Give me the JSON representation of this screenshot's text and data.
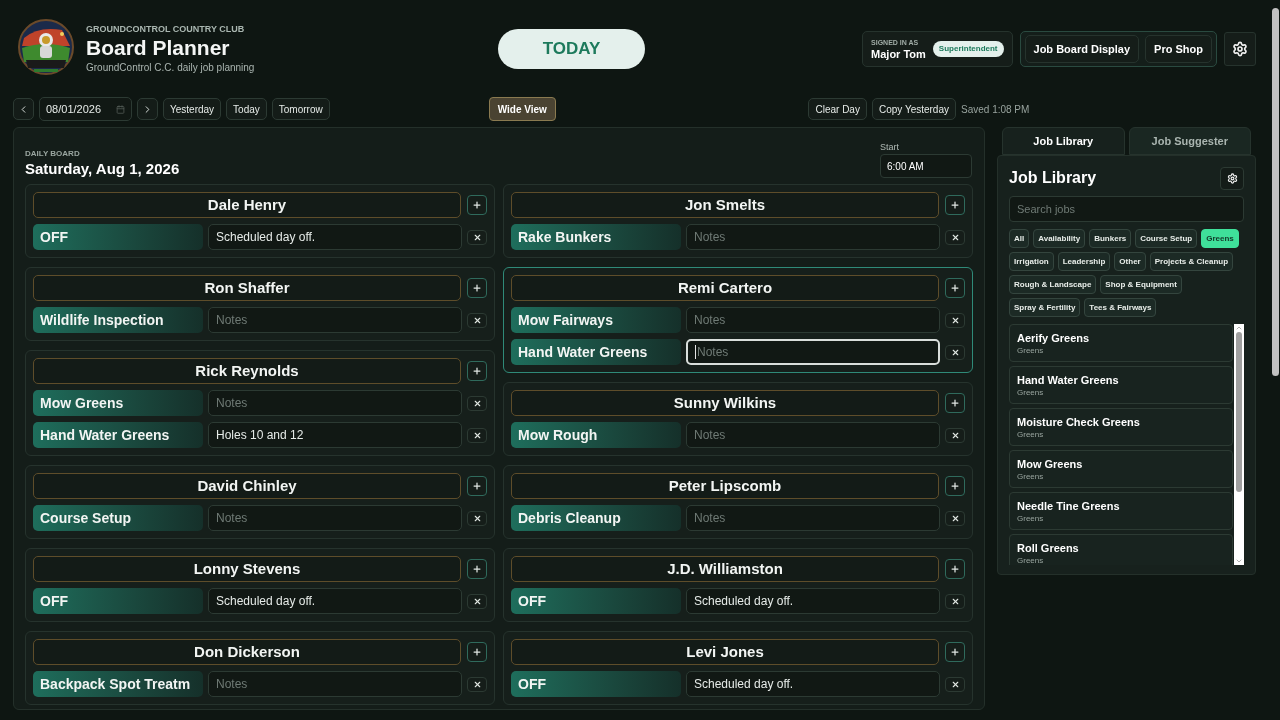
{
  "header": {
    "club": "GROUNDCONTROL COUNTRY CLUB",
    "title": "Board Planner",
    "subtitle": "GroundControl C.C. daily job planning"
  },
  "today_button": "TODAY",
  "user": {
    "caption": "SIGNED IN AS",
    "name": "Major Tom",
    "role": "Superintendent"
  },
  "nav": [
    "Job Board Display",
    "Pro Shop"
  ],
  "toolbar": {
    "date": "08/01/2026",
    "quick": [
      "Yesterday",
      "Today",
      "Tomorrow"
    ],
    "wide_view": "Wide View",
    "clear_day": "Clear Day",
    "copy_yesterday": "Copy Yesterday",
    "saved": "Saved 1:08 PM"
  },
  "board": {
    "caption": "DAILY BOARD",
    "date": "Saturday, Aug 1, 2026",
    "start_label": "Start",
    "start_value": "6:00 AM",
    "columns": [
      [
        {
          "name": "Dale Henry",
          "selected": false,
          "jobs": [
            {
              "job": "OFF",
              "notes": "Scheduled day off.",
              "focused": false
            }
          ]
        },
        {
          "name": "Ron Shaffer",
          "selected": false,
          "jobs": [
            {
              "job": "Wildlife Inspection",
              "placeholder": "Notes",
              "focused": false
            }
          ]
        },
        {
          "name": "Rick Reynolds",
          "selected": false,
          "jobs": [
            {
              "job": "Mow Greens",
              "placeholder": "Notes",
              "focused": false
            },
            {
              "job": "Hand Water Greens",
              "notes": "Holes 10 and 12",
              "focused": false
            }
          ]
        },
        {
          "name": "David Chinley",
          "selected": false,
          "jobs": [
            {
              "job": "Course Setup",
              "placeholder": "Notes",
              "focused": false
            }
          ]
        },
        {
          "name": "Lonny Stevens",
          "selected": false,
          "jobs": [
            {
              "job": "OFF",
              "notes": "Scheduled day off.",
              "focused": false
            }
          ]
        },
        {
          "name": "Don Dickerson",
          "selected": false,
          "jobs": [
            {
              "job": "Backpack Spot Treatm",
              "placeholder": "Notes",
              "focused": false
            }
          ]
        }
      ],
      [
        {
          "name": "Jon Smelts",
          "selected": false,
          "jobs": [
            {
              "job": "Rake Bunkers",
              "placeholder": "Notes",
              "focused": false
            }
          ]
        },
        {
          "name": "Remi Cartero",
          "selected": true,
          "jobs": [
            {
              "job": "Mow Fairways",
              "placeholder": "Notes",
              "focused": false
            },
            {
              "job": "Hand Water Greens",
              "placeholder": "Notes",
              "focused": true
            }
          ]
        },
        {
          "name": "Sunny Wilkins",
          "selected": false,
          "jobs": [
            {
              "job": "Mow Rough",
              "placeholder": "Notes",
              "focused": false
            }
          ]
        },
        {
          "name": "Peter Lipscomb",
          "selected": false,
          "jobs": [
            {
              "job": "Debris Cleanup",
              "placeholder": "Notes",
              "focused": false
            }
          ]
        },
        {
          "name": "J.D. Williamston",
          "selected": false,
          "jobs": [
            {
              "job": "OFF",
              "notes": "Scheduled day off.",
              "focused": false
            }
          ]
        },
        {
          "name": "Levi Jones",
          "selected": false,
          "jobs": [
            {
              "job": "OFF",
              "notes": "Scheduled day off.",
              "focused": false
            }
          ]
        }
      ]
    ]
  },
  "side_panel": {
    "tabs": [
      {
        "label": "Job Library",
        "selected": true
      },
      {
        "label": "Job Suggester",
        "selected": false
      }
    ],
    "title": "Job Library",
    "search": {
      "placeholder": "Search jobs"
    },
    "filters": [
      {
        "label": "All",
        "selected": false
      },
      {
        "label": "Availability",
        "selected": false
      },
      {
        "label": "Bunkers",
        "selected": false
      },
      {
        "label": "Course Setup",
        "selected": false
      },
      {
        "label": "Greens",
        "selected": true
      },
      {
        "label": "Irrigation",
        "selected": false
      },
      {
        "label": "Leadership",
        "selected": false
      },
      {
        "label": "Other",
        "selected": false
      },
      {
        "label": "Projects & Cleanup",
        "selected": false
      },
      {
        "label": "Rough & Landscape",
        "selected": false
      },
      {
        "label": "Shop & Equipment",
        "selected": false
      },
      {
        "label": "Spray & Fertility",
        "selected": false
      },
      {
        "label": "Tees & Fairways",
        "selected": false
      }
    ],
    "jobs": [
      {
        "name": "Aerify Greens",
        "category": "Greens"
      },
      {
        "name": "Hand Water Greens",
        "category": "Greens"
      },
      {
        "name": "Moisture Check Greens",
        "category": "Greens"
      },
      {
        "name": "Mow Greens",
        "category": "Greens"
      },
      {
        "name": "Needle Tine Greens",
        "category": "Greens"
      },
      {
        "name": "Roll Greens",
        "category": "Greens"
      }
    ]
  }
}
